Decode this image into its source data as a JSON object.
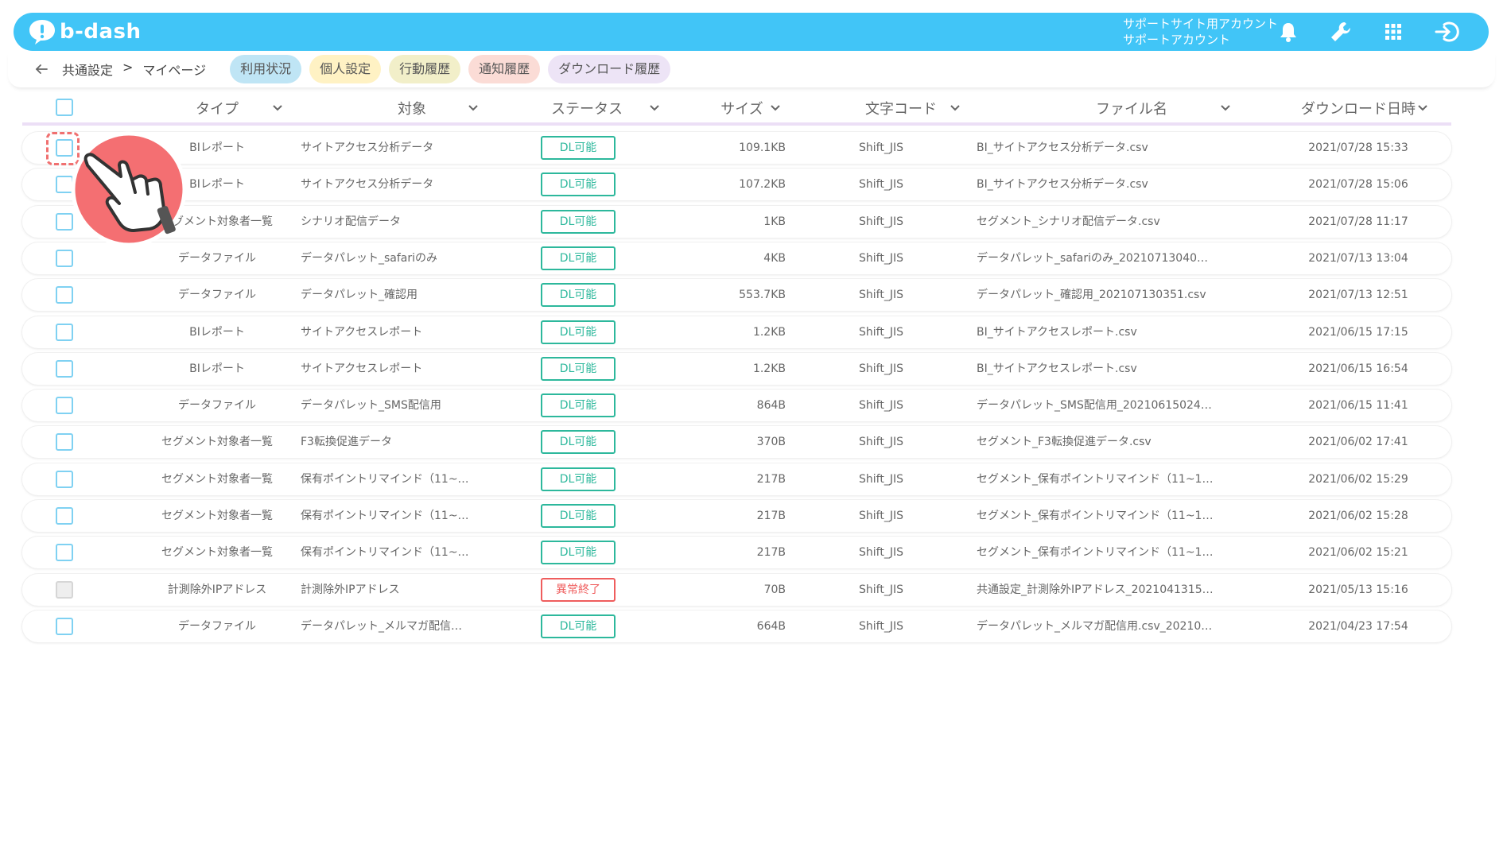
{
  "header": {
    "logo_text": "b-dash",
    "account_line1": "サポートサイト用アカウント",
    "account_line2": "サポートアカウント",
    "icons": [
      "bell-icon",
      "wrench-icon",
      "grid-icon",
      "logout-icon"
    ]
  },
  "subbar": {
    "breadcrumb": [
      "共通設定",
      ">",
      "マイページ"
    ],
    "tabs": [
      {
        "label": "利用状況"
      },
      {
        "label": "個人設定"
      },
      {
        "label": "行動履歴"
      },
      {
        "label": "通知履歴"
      },
      {
        "label": "ダウンロード履歴"
      }
    ]
  },
  "table": {
    "headers": {
      "type": "タイプ",
      "target": "対象",
      "status": "ステータス",
      "size": "サイズ",
      "encoding": "文字コード",
      "filename": "ファイル名",
      "date": "ダウンロード日時"
    },
    "rows": [
      {
        "type": "BIレポート",
        "target": "サイトアクセス分析データ",
        "status": "DL可能",
        "status_kind": "ok",
        "size": "109.1KB",
        "encoding": "Shift_JIS",
        "filename": "BI_サイトアクセス分析データ.csv",
        "date": "2021/07/28 15:33",
        "disabled": false
      },
      {
        "type": "BIレポート",
        "target": "サイトアクセス分析データ",
        "status": "DL可能",
        "status_kind": "ok",
        "size": "107.2KB",
        "encoding": "Shift_JIS",
        "filename": "BI_サイトアクセス分析データ.csv",
        "date": "2021/07/28 15:06",
        "disabled": false
      },
      {
        "type": "セグメント対象者一覧",
        "target": "シナリオ配信データ",
        "status": "DL可能",
        "status_kind": "ok",
        "size": "1KB",
        "encoding": "Shift_JIS",
        "filename": "セグメント_シナリオ配信データ.csv",
        "date": "2021/07/28 11:17",
        "disabled": false
      },
      {
        "type": "データファイル",
        "target": "データパレット_safariのみ",
        "status": "DL可能",
        "status_kind": "ok",
        "size": "4KB",
        "encoding": "Shift_JIS",
        "filename": "データパレット_safariのみ_20210713040…",
        "date": "2021/07/13 13:04",
        "disabled": false
      },
      {
        "type": "データファイル",
        "target": "データパレット_確認用",
        "status": "DL可能",
        "status_kind": "ok",
        "size": "553.7KB",
        "encoding": "Shift_JIS",
        "filename": "データパレット_確認用_202107130351.csv",
        "date": "2021/07/13 12:51",
        "disabled": false
      },
      {
        "type": "BIレポート",
        "target": "サイトアクセスレポート",
        "status": "DL可能",
        "status_kind": "ok",
        "size": "1.2KB",
        "encoding": "Shift_JIS",
        "filename": "BI_サイトアクセスレポート.csv",
        "date": "2021/06/15 17:15",
        "disabled": false
      },
      {
        "type": "BIレポート",
        "target": "サイトアクセスレポート",
        "status": "DL可能",
        "status_kind": "ok",
        "size": "1.2KB",
        "encoding": "Shift_JIS",
        "filename": "BI_サイトアクセスレポート.csv",
        "date": "2021/06/15 16:54",
        "disabled": false
      },
      {
        "type": "データファイル",
        "target": "データパレット_SMS配信用",
        "status": "DL可能",
        "status_kind": "ok",
        "size": "864B",
        "encoding": "Shift_JIS",
        "filename": "データパレット_SMS配信用_20210615024…",
        "date": "2021/06/15 11:41",
        "disabled": false
      },
      {
        "type": "セグメント対象者一覧",
        "target": "F3転換促進データ",
        "status": "DL可能",
        "status_kind": "ok",
        "size": "370B",
        "encoding": "Shift_JIS",
        "filename": "セグメント_F3転換促進データ.csv",
        "date": "2021/06/02 17:41",
        "disabled": false
      },
      {
        "type": "セグメント対象者一覧",
        "target": "保有ポイントリマインド（11~…",
        "status": "DL可能",
        "status_kind": "ok",
        "size": "217B",
        "encoding": "Shift_JIS",
        "filename": "セグメント_保有ポイントリマインド（11~1…",
        "date": "2021/06/02 15:29",
        "disabled": false
      },
      {
        "type": "セグメント対象者一覧",
        "target": "保有ポイントリマインド（11~…",
        "status": "DL可能",
        "status_kind": "ok",
        "size": "217B",
        "encoding": "Shift_JIS",
        "filename": "セグメント_保有ポイントリマインド（11~1…",
        "date": "2021/06/02 15:28",
        "disabled": false
      },
      {
        "type": "セグメント対象者一覧",
        "target": "保有ポイントリマインド（11~…",
        "status": "DL可能",
        "status_kind": "ok",
        "size": "217B",
        "encoding": "Shift_JIS",
        "filename": "セグメント_保有ポイントリマインド（11~1…",
        "date": "2021/06/02 15:21",
        "disabled": false
      },
      {
        "type": "計測除外IPアドレス",
        "target": "計測除外IPアドレス",
        "status": "異常終了",
        "status_kind": "error",
        "size": "70B",
        "encoding": "Shift_JIS",
        "filename": "共通設定_計測除外IPアドレス_2021041315…",
        "date": "2021/05/13 15:16",
        "disabled": true
      },
      {
        "type": "データファイル",
        "target": "データパレット_メルマガ配信…",
        "status": "DL可能",
        "status_kind": "ok",
        "size": "664B",
        "encoding": "Shift_JIS",
        "filename": "データパレット_メルマガ配信用.csv_20210…",
        "date": "2021/04/23 17:54",
        "disabled": false
      }
    ]
  },
  "colors": {
    "header_bg": "#41c5f7",
    "status_ok": "#2db89c",
    "status_error": "#ef5d5d",
    "checkbox_border": "#7fd1f2",
    "pointer_bg": "#f46f72"
  }
}
